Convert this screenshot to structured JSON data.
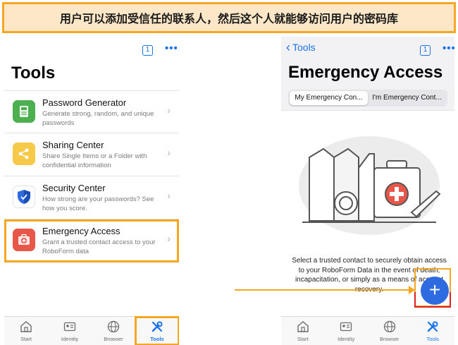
{
  "banner": {
    "text": "用户可以添加受信任的联系人，然后这个人就能够访问用户的密码库"
  },
  "left_screen": {
    "tab_count": "1",
    "more": "•••",
    "title": "Tools",
    "tools": [
      {
        "name": "Password Generator",
        "desc": "Generate strong, random, and unique passwords",
        "icon": "password-generator-icon",
        "color": "#4caf50"
      },
      {
        "name": "Sharing Center",
        "desc": "Share Single Items or a Folder with confidential information",
        "icon": "share-icon",
        "color": "#f7c948"
      },
      {
        "name": "Security Center",
        "desc": "How strong are your passwords? See how you score.",
        "icon": "shield-icon",
        "color": "#2f6be0"
      },
      {
        "name": "Emergency Access",
        "desc": "Grant a trusted contact access to your RoboForm data",
        "icon": "first-aid-kit-icon",
        "color": "#e8564a"
      }
    ],
    "tabbar": [
      "Start",
      "Identity",
      "Browser",
      "Tools"
    ]
  },
  "right_screen": {
    "back_label": "Tools",
    "tab_count": "1",
    "more": "•••",
    "title": "Emergency Access",
    "segments": [
      "My Emergency Con...",
      "I'm Emergency Cont..."
    ],
    "empty_text": "Select a trusted contact to securely obtain access to your RoboForm Data in the event of death, incapacitation, or simply as a means of account recovery.",
    "fab_label": "+",
    "tabbar": [
      "Start",
      "Identity",
      "Browser",
      "Tools"
    ]
  },
  "colors": {
    "accent": "#1a73e8",
    "highlight": "#f5a623",
    "fab": "#2f6be0",
    "red_marker": "#e02020"
  }
}
